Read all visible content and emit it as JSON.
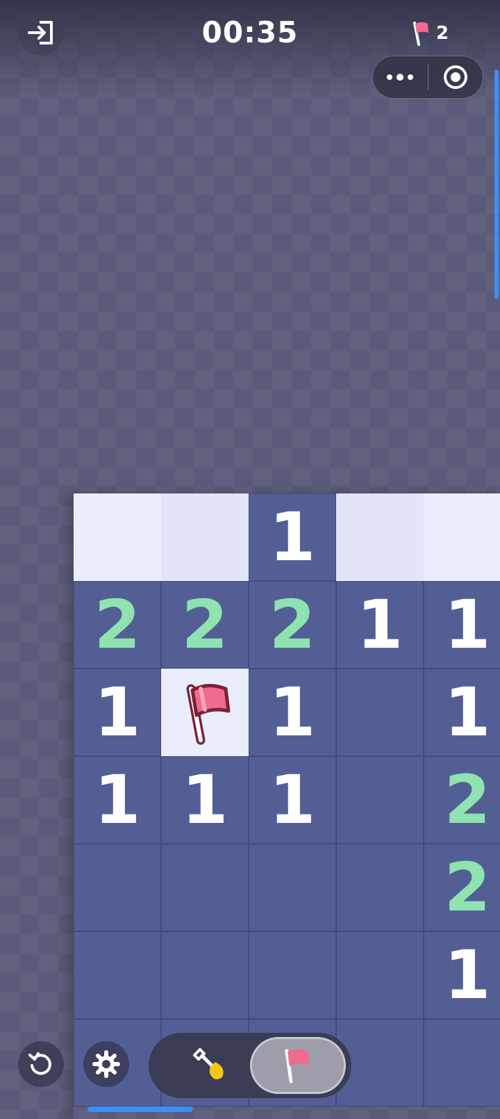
{
  "header": {
    "timer": "00:35",
    "flags_remaining": "2",
    "exit_icon": "exit-icon",
    "flag_icon": "flag-icon"
  },
  "capsule": {
    "more_icon": "more-dots-icon",
    "target_icon": "target-icon"
  },
  "board": {
    "rows": [
      [
        "?",
        "?",
        "1",
        "?",
        "?"
      ],
      [
        "2",
        "2",
        "2",
        "1",
        "1"
      ],
      [
        "1",
        "F",
        "1",
        "",
        "1"
      ],
      [
        "1",
        "1",
        "1",
        "",
        "2"
      ],
      [
        "",
        "",
        "",
        "",
        "2"
      ],
      [
        "",
        "",
        "",
        "",
        "1"
      ],
      [
        "",
        "",
        "",
        "",
        ""
      ]
    ],
    "legend": {
      "?": "hidden",
      "F": "flagged",
      "": "revealed-empty"
    }
  },
  "toolbar": {
    "undo_icon": "undo-icon",
    "settings_icon": "gear-icon",
    "dig_icon": "shovel-icon",
    "flag_mode_icon": "flag-icon",
    "active_mode": "flag"
  },
  "colors": {
    "revealed_cell": "#535f94",
    "hidden_cell": "#eaedfb",
    "number_one": "#ffffff",
    "number_two": "#8ee3b0",
    "flag": "#f06b8f",
    "accent_blue": "#3f8ff0"
  }
}
